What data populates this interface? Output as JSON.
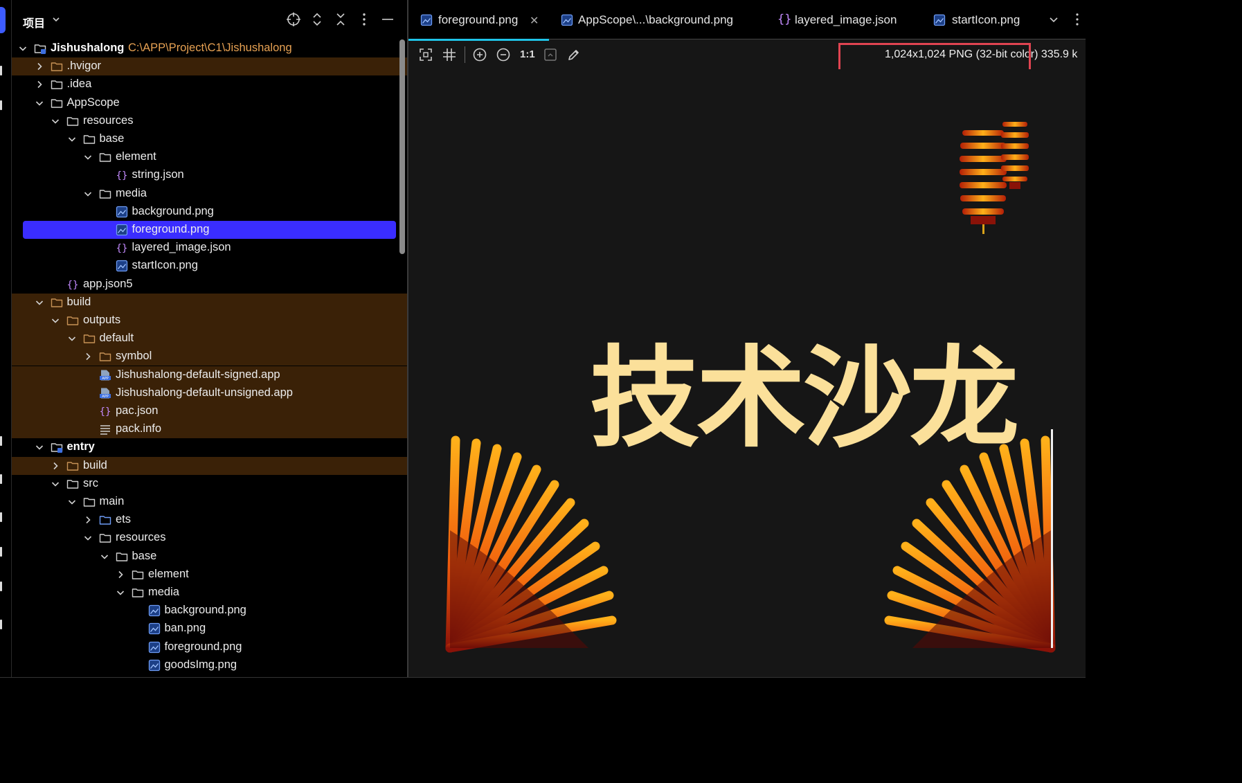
{
  "project_panel": {
    "title": "项目",
    "root": {
      "name": "Jishushalong",
      "path": "C:\\APP\\Project\\C1\\Jishushalong"
    },
    "items": [
      {
        "label": ".hvigor"
      },
      {
        "label": ".idea"
      },
      {
        "label": "AppScope"
      },
      {
        "label": "resources"
      },
      {
        "label": "base"
      },
      {
        "label": "element"
      },
      {
        "label": "string.json"
      },
      {
        "label": "media"
      },
      {
        "label": "background.png"
      },
      {
        "label": "foreground.png"
      },
      {
        "label": "layered_image.json"
      },
      {
        "label": "startIcon.png"
      },
      {
        "label": "app.json5"
      },
      {
        "label": "build"
      },
      {
        "label": "outputs"
      },
      {
        "label": "default"
      },
      {
        "label": "symbol"
      },
      {
        "label": "Jishushalong-default-signed.app"
      },
      {
        "label": "Jishushalong-default-unsigned.app"
      },
      {
        "label": "pac.json"
      },
      {
        "label": "pack.info"
      },
      {
        "label": "entry"
      },
      {
        "label": "build"
      },
      {
        "label": "src"
      },
      {
        "label": "main"
      },
      {
        "label": "ets"
      },
      {
        "label": "resources"
      },
      {
        "label": "base"
      },
      {
        "label": "element"
      },
      {
        "label": "media"
      },
      {
        "label": "background.png"
      },
      {
        "label": "ban.png"
      },
      {
        "label": "foreground.png"
      },
      {
        "label": "goodsImg.png"
      }
    ]
  },
  "tabs": [
    {
      "label": "foreground.png",
      "active": true
    },
    {
      "label": "AppScope\\...\\background.png"
    },
    {
      "label": "layered_image.json"
    },
    {
      "label": "startIcon.png"
    }
  ],
  "toolbar": {
    "actual_size": "1:1"
  },
  "image_info": "1,024x1,024 PNG (32-bit color) 335.9 k",
  "image_text": "技术沙龙",
  "colors": {
    "selection": "#3a2dff",
    "excluded_bg": "#3a2107",
    "path": "#e8a253",
    "active_tab": "#20c4e8",
    "highlight_box": "#e04451",
    "calligraphy": "#fbe09a"
  }
}
